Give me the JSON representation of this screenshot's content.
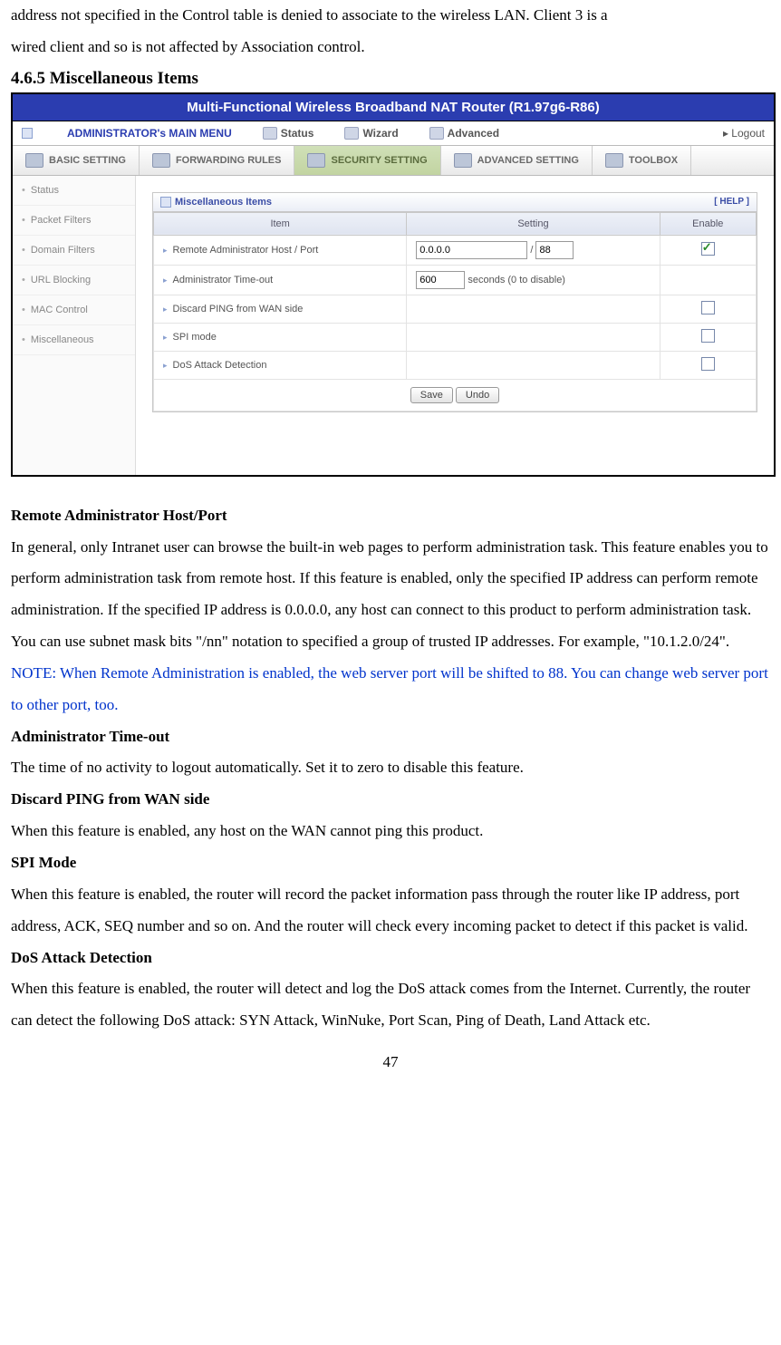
{
  "topText": {
    "line1": "address not specified in the Control table is denied to associate to the wireless LAN. Client 3 is a",
    "line2": "wired client and so is not affected by Association control."
  },
  "heading": "4.6.5 Miscellaneous Items",
  "shot": {
    "title": "Multi-Functional Wireless Broadband NAT Router (R1.97g6-R86)",
    "menuLabel": "ADMINISTRATOR's MAIN MENU",
    "menu": [
      "Status",
      "Wizard",
      "Advanced"
    ],
    "logout": "▸ Logout",
    "tabs": [
      "BASIC SETTING",
      "FORWARDING RULES",
      "SECURITY SETTING",
      "ADVANCED SETTING",
      "TOOLBOX"
    ],
    "side": [
      "Status",
      "Packet Filters",
      "Domain Filters",
      "URL Blocking",
      "MAC Control",
      "Miscellaneous"
    ],
    "panelTitle": "Miscellaneous Items",
    "help": "[ HELP ]",
    "th": {
      "item": "Item",
      "setting": "Setting",
      "enable": "Enable"
    },
    "rows": {
      "r1": {
        "label": "Remote Administrator Host / Port",
        "host": "0.0.0.0",
        "slash": "/",
        "port": "88"
      },
      "r2": {
        "label": "Administrator Time-out",
        "val": "600",
        "suffix": "seconds (0 to disable)"
      },
      "r3": {
        "label": "Discard PING from WAN side"
      },
      "r4": {
        "label": "SPI mode"
      },
      "r5": {
        "label": "DoS Attack Detection"
      }
    },
    "save": "Save",
    "undo": "Undo"
  },
  "desc": {
    "h1": "Remote Administrator Host/Port",
    "p1": "In general, only Intranet user can browse the built-in web pages to perform administration task. This feature enables you to perform administration task from remote host. If this feature is enabled, only the specified IP address can perform remote administration. If the specified IP address is 0.0.0.0, any host can connect to this product to perform administration task. You can use subnet mask bits \"/nn\" notation to specified a group of trusted IP addresses. For example, \"10.1.2.0/24\".",
    "note": "NOTE: When Remote Administration is enabled, the web server port will be shifted to 88. You can change web server port to other port, too.",
    "h2": "Administrator Time-out",
    "p2": "The time of no activity to logout automatically. Set it to zero to disable this feature.",
    "h3": "Discard PING from WAN side",
    "p3": "When this feature is enabled, any host on the WAN cannot ping this product.",
    "h4": "SPI Mode",
    "p4": "When this feature is enabled, the router will record the packet information pass through the router like IP address, port address, ACK, SEQ number and so on. And the router will check every incoming packet to detect if this packet is valid.",
    "h5": "DoS Attack Detection",
    "p5": "When this feature is enabled, the router will detect and log the DoS attack comes from the Internet. Currently, the router can detect the following DoS attack: SYN Attack, WinNuke, Port Scan, Ping of Death, Land Attack etc."
  },
  "pageNumber": "47"
}
